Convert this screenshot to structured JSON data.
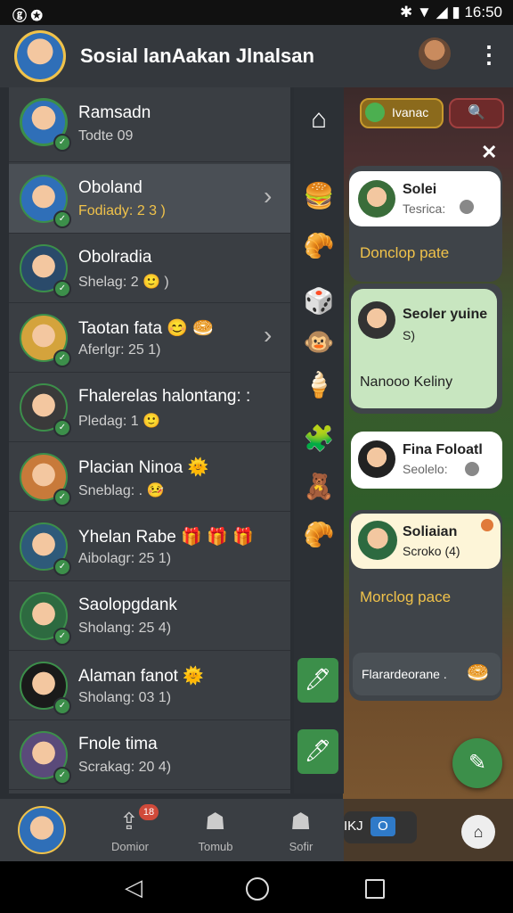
{
  "status_bar": {
    "left_icons": "ⓖ ✪",
    "time": "16:50",
    "right_icons": "✱ ▼ ◢ ▮"
  },
  "app_bar": {
    "title": "Sosial lanAakan Jlnalsan",
    "menu_icon": "⋮"
  },
  "header_user": {
    "name": "Ramsadn",
    "status": "Todte 09"
  },
  "contacts": [
    {
      "name": "Oboland",
      "status": "Fodiady: 2 3 )",
      "highlight": true,
      "chevron": "›"
    },
    {
      "name": "Obolradia",
      "status": "Shelag: 2 🙂 )"
    },
    {
      "name": "Taotan fata 😊 🥯",
      "status": "Aferlgr: 25 1)",
      "chevron": "›"
    },
    {
      "name": "Fhalerelas halontang: :",
      "status": "Pledag: 1 🙂"
    },
    {
      "name": "Placian Ninoa 🌞",
      "status": "Sneblag: . 🤒"
    },
    {
      "name": "Yhelan Rabe 🎁 🎁 🎁",
      "status": "Aibolagr: 25 1)"
    },
    {
      "name": "Saolopgdank",
      "status": "Sholang: 25 4)"
    },
    {
      "name": "Alaman fanot 🌞",
      "status": "Sholang: 03 1)"
    },
    {
      "name": "Fnole tima",
      "status": "Scrakag: 20 4)"
    }
  ],
  "icon_column": [
    "⌂",
    "🍔",
    "🥐",
    "🎲",
    "🐵",
    "🍦",
    "🧩",
    "🧸",
    "🥐",
    "🖊",
    "🖊"
  ],
  "top_chips": {
    "chip1": "Ivanac",
    "chip2": "🔍"
  },
  "close_icon": "✕",
  "cards": [
    {
      "name": "Solei",
      "sub": "Tesrica:"
    },
    {
      "link": "Donclop pate"
    },
    {
      "name": "Seoler yuine",
      "sub": "S)",
      "extra": "Nanooo Keliny"
    },
    {
      "name": "Fina Foloatl",
      "sub": "Seolelo:"
    },
    {
      "name": "Soliaian",
      "sub": "Scroko (4)"
    },
    {
      "link": "Morclog pace"
    },
    {
      "label": "Flarardeorane ."
    }
  ],
  "bottom_tabs": [
    {
      "label": "",
      "badge": ""
    },
    {
      "label": "Domior",
      "badge": "18"
    },
    {
      "label": "Tomub",
      "badge": ""
    },
    {
      "label": "Sofir",
      "badge": ""
    }
  ],
  "bottom_right": {
    "text": "IKJ",
    "chip": "O"
  },
  "colors": {
    "accent": "#3c8f4a",
    "card_green": "#c8e6c0",
    "card_cream": "#fdf5d8",
    "link_yellow": "#f0c24a"
  }
}
